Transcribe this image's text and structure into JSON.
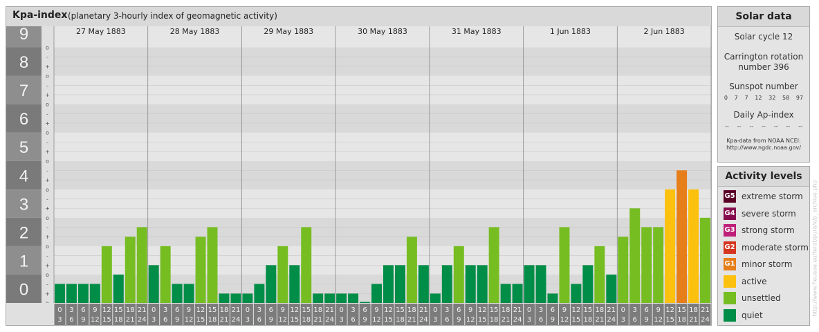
{
  "chart_header": {
    "title": "Kpa-index",
    "subtitle": "(planetary 3-hourly index of geomagnetic activity)"
  },
  "solar_data": {
    "title": "Solar data",
    "solar_cycle": "Solar cycle 12",
    "carrington_line1": "Carrington rotation",
    "carrington_line2": "number 396",
    "sunspot_label": "Sunspot number",
    "sunspot_values": [
      "0",
      "7",
      "7",
      "12",
      "32",
      "58",
      "97"
    ],
    "ap_label": "Daily Ap-index",
    "ap_values": [
      "--",
      "--",
      "--",
      "--",
      "--",
      "--",
      "--"
    ],
    "source_line1": "Kpa-data from NOAA NCEI:",
    "source_line2": "http://www.ngdc.noaa.gov/"
  },
  "activity_levels": {
    "title": "Activity levels",
    "items": [
      {
        "badge": "G5",
        "label": "extreme storm",
        "color": "#5a0026"
      },
      {
        "badge": "G4",
        "label": "severe storm",
        "color": "#850d4e"
      },
      {
        "badge": "G3",
        "label": "strong storm",
        "color": "#be1f78"
      },
      {
        "badge": "G2",
        "label": "moderate storm",
        "color": "#d6351f"
      },
      {
        "badge": "G1",
        "label": "minor storm",
        "color": "#e67e1a"
      },
      {
        "badge": "",
        "label": "active",
        "color": "#fcc00e"
      },
      {
        "badge": "",
        "label": "unsettled",
        "color": "#76bd22"
      },
      {
        "badge": "",
        "label": "quiet",
        "color": "#008d47"
      }
    ]
  },
  "watermark": "http://www.fleuaae.eu/ferat/pura/k/p_archive.php",
  "chart_data": {
    "type": "bar",
    "title": "Kpa-index",
    "subtitle": "(planetary 3-hourly index of geomagnetic activity)",
    "ylim": [
      0,
      9.5
    ],
    "y_major_ticks": [
      "0",
      "1",
      "2",
      "3",
      "4",
      "5",
      "6",
      "7",
      "8",
      "9"
    ],
    "y_minor_ticks": [
      "o",
      "+",
      "-"
    ],
    "days": [
      "27 May 1883",
      "28 May 1883",
      "29 May 1883",
      "30 May 1883",
      "31 May 1883",
      "1 Jun 1883",
      "2 Jun 1883"
    ],
    "interval_start_labels": [
      "0",
      "3",
      "6",
      "9",
      "12",
      "15",
      "18",
      "21"
    ],
    "interval_end_labels": [
      "3",
      "6",
      "9",
      "12",
      "15",
      "18",
      "21",
      "24"
    ],
    "values": [
      0.67,
      0.67,
      0.67,
      0.67,
      2.0,
      1.0,
      2.33,
      2.67,
      1.33,
      2.0,
      0.67,
      0.67,
      2.33,
      2.67,
      0.33,
      0.33,
      0.33,
      0.67,
      1.33,
      2.0,
      1.33,
      2.67,
      0.33,
      0.33,
      0.33,
      0.33,
      0.0,
      0.67,
      1.33,
      1.33,
      2.33,
      1.33,
      0.33,
      1.33,
      2.0,
      1.33,
      1.33,
      2.67,
      0.67,
      0.67,
      1.33,
      1.33,
      0.33,
      2.67,
      0.67,
      1.33,
      2.0,
      1.0,
      2.33,
      3.33,
      2.67,
      2.67,
      4.0,
      4.67,
      4.0,
      3.0
    ],
    "grid": true
  }
}
